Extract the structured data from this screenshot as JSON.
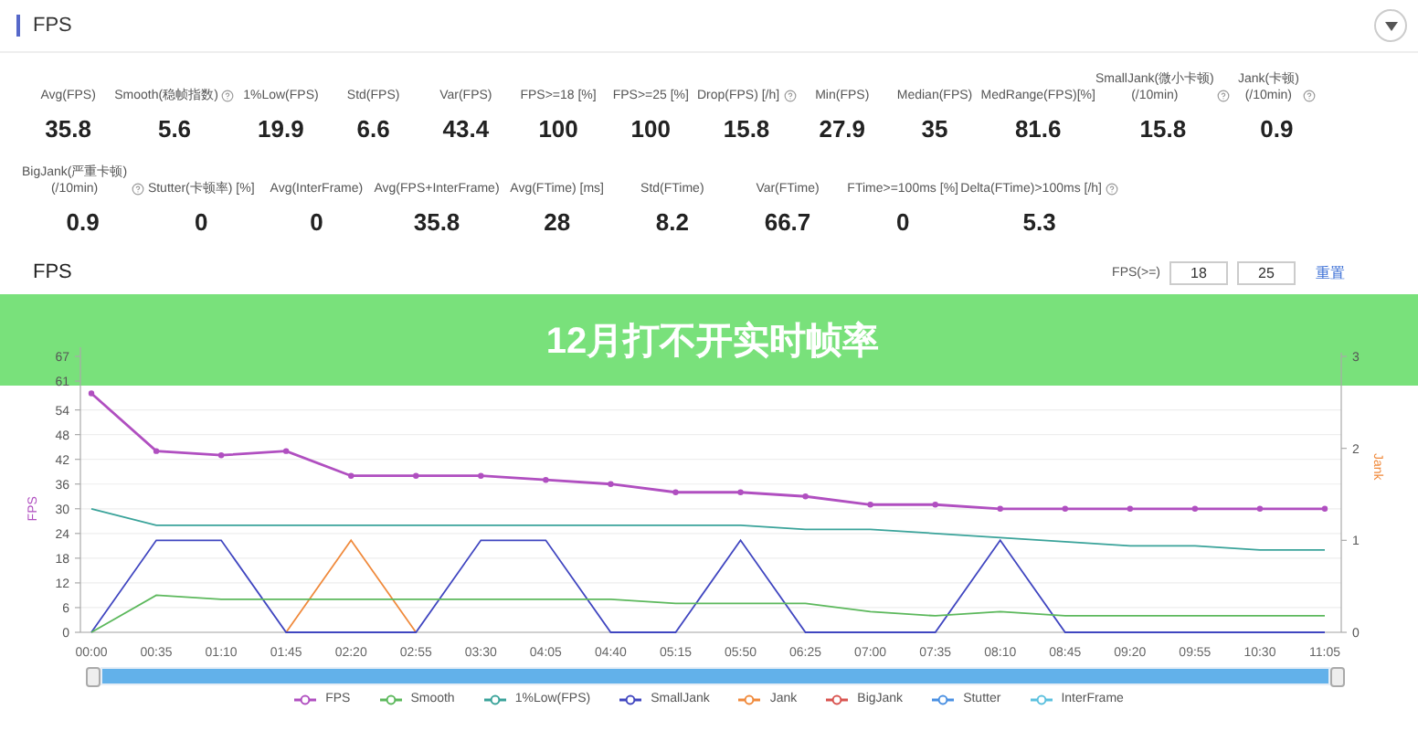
{
  "header": {
    "title": "FPS"
  },
  "stats_row_1": [
    {
      "label": "Avg(FPS)",
      "value": "35.8",
      "help": false
    },
    {
      "label": "Smooth(稳帧指数)",
      "value": "5.6",
      "help": true
    },
    {
      "label": "1%Low(FPS)",
      "value": "19.9",
      "help": false
    },
    {
      "label": "Std(FPS)",
      "value": "6.6",
      "help": false
    },
    {
      "label": "Var(FPS)",
      "value": "43.4",
      "help": false
    },
    {
      "label": "FPS>=18 [%]",
      "value": "100",
      "help": false
    },
    {
      "label": "FPS>=25 [%]",
      "value": "100",
      "help": false
    },
    {
      "label": "Drop(FPS) [/h]",
      "value": "15.8",
      "help": true
    },
    {
      "label": "Min(FPS)",
      "value": "27.9",
      "help": false
    },
    {
      "label": "Median(FPS)",
      "value": "35",
      "help": false
    },
    {
      "label": "MedRange(FPS)[%]",
      "value": "81.6",
      "help": false
    },
    {
      "label": "SmallJank(微小卡顿)\n(/10min)",
      "value": "15.8",
      "help": true
    },
    {
      "label": "Jank(卡顿)\n(/10min)",
      "value": "0.9",
      "help": true
    }
  ],
  "stats_row_2": [
    {
      "label": "BigJank(严重卡顿)\n(/10min)",
      "value": "0.9",
      "help": true
    },
    {
      "label": "Stutter(卡顿率) [%]",
      "value": "0",
      "help": false
    },
    {
      "label": "Avg(InterFrame)",
      "value": "0",
      "help": false
    },
    {
      "label": "Avg(FPS+InterFrame)",
      "value": "35.8",
      "help": false
    },
    {
      "label": "Avg(FTime) [ms]",
      "value": "28",
      "help": false
    },
    {
      "label": "Std(FTime)",
      "value": "8.2",
      "help": false
    },
    {
      "label": "Var(FTime)",
      "value": "66.7",
      "help": false
    },
    {
      "label": "FTime>=100ms [%]",
      "value": "0",
      "help": false
    },
    {
      "label": "Delta(FTime)>100ms [/h]",
      "value": "5.3",
      "help": true
    }
  ],
  "section": {
    "title": "FPS",
    "threshold_label": "FPS(>=)",
    "threshold_inputs": [
      "18",
      "25"
    ],
    "reset_link": "重置"
  },
  "chart_data": {
    "type": "line",
    "ylabel": "FPS",
    "y2label": "Jank",
    "categories": [
      "00:00",
      "00:35",
      "01:10",
      "01:45",
      "02:20",
      "02:55",
      "03:30",
      "04:05",
      "04:40",
      "05:15",
      "05:50",
      "06:25",
      "07:00",
      "07:35",
      "08:10",
      "08:45",
      "09:20",
      "09:55",
      "10:30",
      "11:05"
    ],
    "grid": true,
    "ylim": [
      0,
      67
    ],
    "yticks": [
      0,
      6,
      12,
      18,
      24,
      30,
      36,
      42,
      48,
      54,
      61,
      67
    ],
    "y2lim": [
      0,
      3
    ],
    "y2ticks": [
      0,
      1,
      2,
      3
    ],
    "series": [
      {
        "name": "FPS",
        "color": "#b04fc0",
        "marker": "circle",
        "values": [
          58,
          44,
          43,
          44,
          38,
          38,
          38,
          37,
          36,
          34,
          34,
          33,
          31,
          31,
          30,
          30,
          30,
          30,
          30,
          30
        ]
      },
      {
        "name": "Smooth",
        "color": "#5cb85c",
        "values": [
          0,
          9,
          8,
          8,
          8,
          8,
          8,
          8,
          8,
          7,
          7,
          7,
          5,
          4,
          5,
          4,
          4,
          4,
          4,
          4
        ]
      },
      {
        "name": "1%Low(FPS)",
        "color": "#3aa39a",
        "values": [
          30,
          26,
          26,
          26,
          26,
          26,
          26,
          26,
          26,
          26,
          26,
          25,
          25,
          24,
          23,
          22,
          21,
          21,
          20,
          20
        ]
      },
      {
        "name": "SmallJank",
        "color": "#4046c0",
        "axis": "y2",
        "values": [
          0,
          1,
          1,
          0,
          0,
          0,
          1,
          1,
          0,
          0,
          1,
          0,
          0,
          0,
          1,
          0,
          0,
          0,
          0,
          0
        ]
      },
      {
        "name": "Jank",
        "color": "#f08a3c",
        "axis": "y2",
        "values": [
          null,
          null,
          null,
          0,
          1,
          0,
          null,
          null,
          null,
          null,
          null,
          null,
          null,
          null,
          null,
          null,
          null,
          null,
          null,
          null
        ]
      },
      {
        "name": "BigJank",
        "color": "#d9534f",
        "axis": "y2",
        "values": [
          null,
          null,
          null,
          null,
          null,
          null,
          null,
          null,
          null,
          null,
          null,
          null,
          null,
          null,
          null,
          null,
          null,
          null,
          null,
          null
        ]
      },
      {
        "name": "Stutter",
        "color": "#4a90e2",
        "axis": "y2",
        "values": [
          null,
          null,
          null,
          null,
          null,
          null,
          null,
          null,
          null,
          null,
          null,
          null,
          null,
          null,
          null,
          null,
          null,
          null,
          null,
          null
        ]
      },
      {
        "name": "InterFrame",
        "color": "#5bc0de",
        "axis": "y2",
        "values": [
          null,
          null,
          null,
          null,
          null,
          null,
          null,
          null,
          null,
          null,
          null,
          null,
          null,
          null,
          null,
          null,
          null,
          null,
          null,
          null
        ]
      }
    ]
  },
  "range_slider": {
    "level": 1
  },
  "banner": {
    "text": "12月打不开实时帧率"
  }
}
